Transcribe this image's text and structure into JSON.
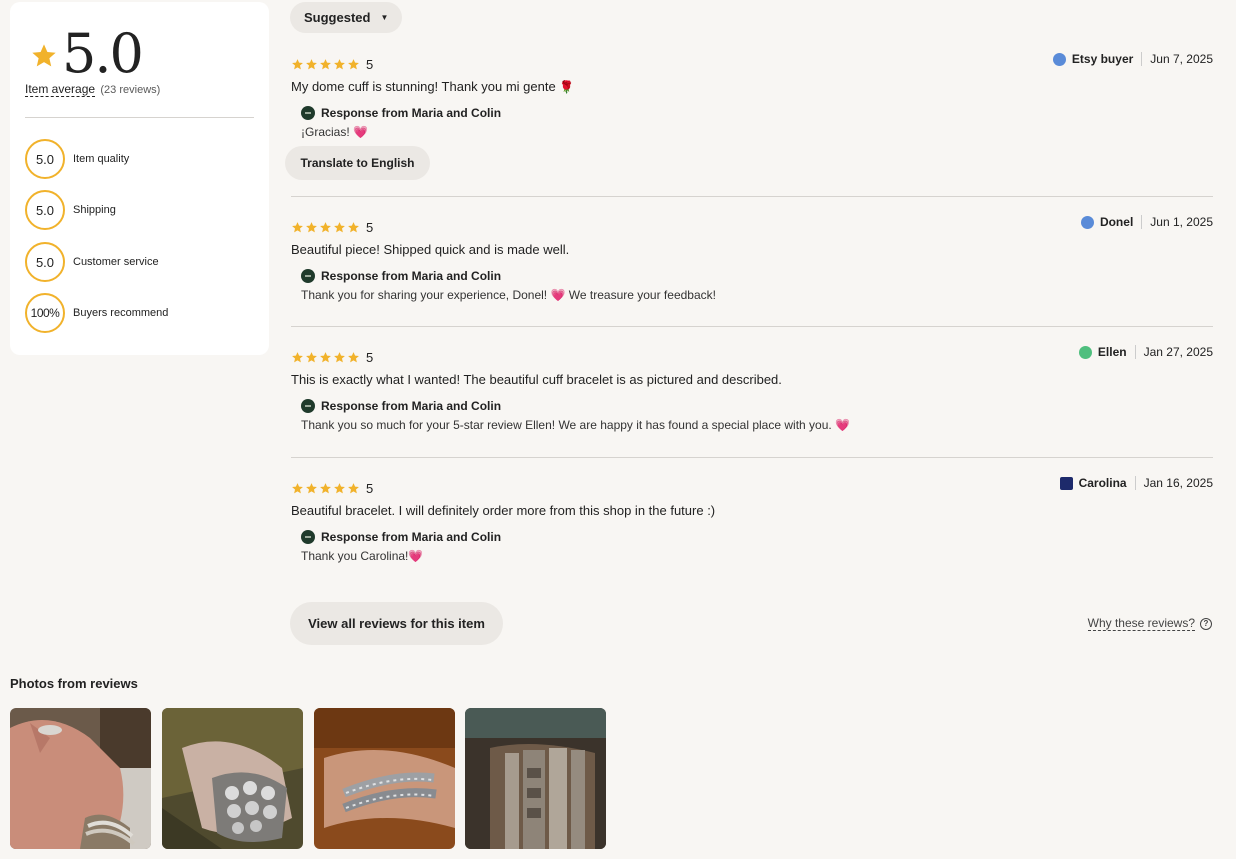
{
  "summary": {
    "score": "5.0",
    "avg_label": "Item average",
    "count": "(23 reviews)",
    "metrics": [
      {
        "value": "5.0",
        "label": "Item quality"
      },
      {
        "value": "5.0",
        "label": "Shipping"
      },
      {
        "value": "5.0",
        "label": "Customer service"
      },
      {
        "value": "100%",
        "label": "Buyers recommend"
      }
    ]
  },
  "sort": {
    "label": "Suggested"
  },
  "reviews": [
    {
      "rating": "5",
      "text": "My dome cuff is stunning! Thank you mi gente",
      "user": "Etsy buyer",
      "date": "Jun 7, 2025",
      "response_title": "Response from Maria and Colin",
      "response": "¡Gracias!"
    },
    {
      "rating": "5",
      "text": "Beautiful piece! Shipped quick and is made well.",
      "user": "Donel",
      "date": "Jun 1, 2025",
      "response_title": "Response from Maria and Colin",
      "response": "Thank you for sharing your experience, Donel!",
      "response_tail": "We treasure your feedback!"
    },
    {
      "rating": "5",
      "text": "This is exactly what I wanted! The beautiful cuff bracelet is as pictured and described.",
      "user": "Ellen",
      "date": "Jan 27, 2025",
      "response_title": "Response from Maria and Colin",
      "response": "Thank you so much for your 5-star review Ellen! We are happy it has found a special place with you."
    },
    {
      "rating": "5",
      "text": "Beautiful bracelet. I will definitely order more from this shop in the future :)",
      "user": "Carolina",
      "date": "Jan 16, 2025",
      "response_title": "Response from Maria and Colin",
      "response": "Thank you Carolina!"
    }
  ],
  "translate": {
    "label": "Translate to English"
  },
  "view_all": {
    "label": "View all reviews for this item"
  },
  "why": {
    "label": "Why these reviews?"
  },
  "photos": {
    "title": "Photos from reviews"
  },
  "colors": {
    "star": "#f1b22b",
    "heart": "#e03a60",
    "ring": "#f1b22b"
  }
}
